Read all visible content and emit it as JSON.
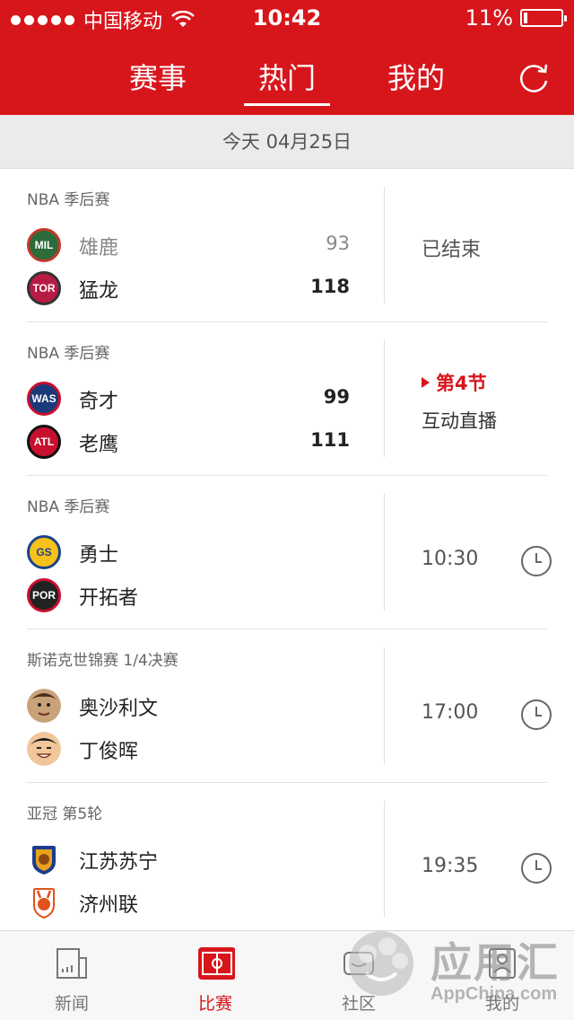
{
  "status_bar": {
    "carrier": "中国移动",
    "time": "10:42",
    "battery": "11%",
    "battery_level": 0.11,
    "signal_dots": 5
  },
  "nav": {
    "tabs": [
      {
        "label": "赛事"
      },
      {
        "label": "热门",
        "active": true
      },
      {
        "label": "我的"
      }
    ],
    "refresh_icon": "refresh-icon"
  },
  "date_bar": {
    "text": "今天 04月25日"
  },
  "matches": [
    {
      "league": "NBA 季后赛",
      "team1": {
        "name": "雄鹿",
        "score": "93",
        "abbr": "MIL",
        "color": "#2d6b3a",
        "ring": "#c0392b"
      },
      "team2": {
        "name": "猛龙",
        "score": "118",
        "abbr": "TOR",
        "color": "#b71c44",
        "ring": "#333333"
      },
      "status": "已结束"
    },
    {
      "league": "NBA 季后赛",
      "team1": {
        "name": "奇才",
        "score": "99",
        "abbr": "WAS",
        "color": "#1b3a7a",
        "ring": "#c8102e"
      },
      "team2": {
        "name": "老鹰",
        "score": "111",
        "abbr": "ATL",
        "color": "#c8102e",
        "ring": "#111111"
      },
      "live_period": "第4节",
      "live_text": "互动直播"
    },
    {
      "league": "NBA 季后赛",
      "team1": {
        "name": "勇士",
        "abbr": "GS",
        "color": "#f6c21a",
        "ring": "#1d428a"
      },
      "team2": {
        "name": "开拓者",
        "abbr": "POR",
        "color": "#222222",
        "ring": "#c8102e"
      },
      "time": "10:30"
    },
    {
      "league": "斯诺克世锦赛 1/4决赛",
      "team1": {
        "name": "奥沙利文",
        "avatar": "player-avatar"
      },
      "team2": {
        "name": "丁俊晖",
        "avatar": "player-avatar"
      },
      "time": "17:00"
    },
    {
      "league": "亚冠 第5轮",
      "team1": {
        "name": "江苏苏宁",
        "avatar": "club-crest"
      },
      "team2": {
        "name": "济州联",
        "avatar": "club-crest"
      },
      "time": "19:35"
    }
  ],
  "tab_bar": {
    "items": [
      {
        "label": "新闻",
        "icon": "newspaper-icon"
      },
      {
        "label": "比赛",
        "icon": "pitch-icon",
        "active": true
      },
      {
        "label": "社区",
        "icon": "community-icon"
      },
      {
        "label": "我的",
        "icon": "profile-icon"
      }
    ]
  },
  "watermark": {
    "main": "应用汇",
    "sub": "AppChina.com"
  },
  "colors": {
    "brand_red": "#d7161c",
    "divider": "#e2e2e2",
    "date_bar_bg": "#ebebeb"
  }
}
